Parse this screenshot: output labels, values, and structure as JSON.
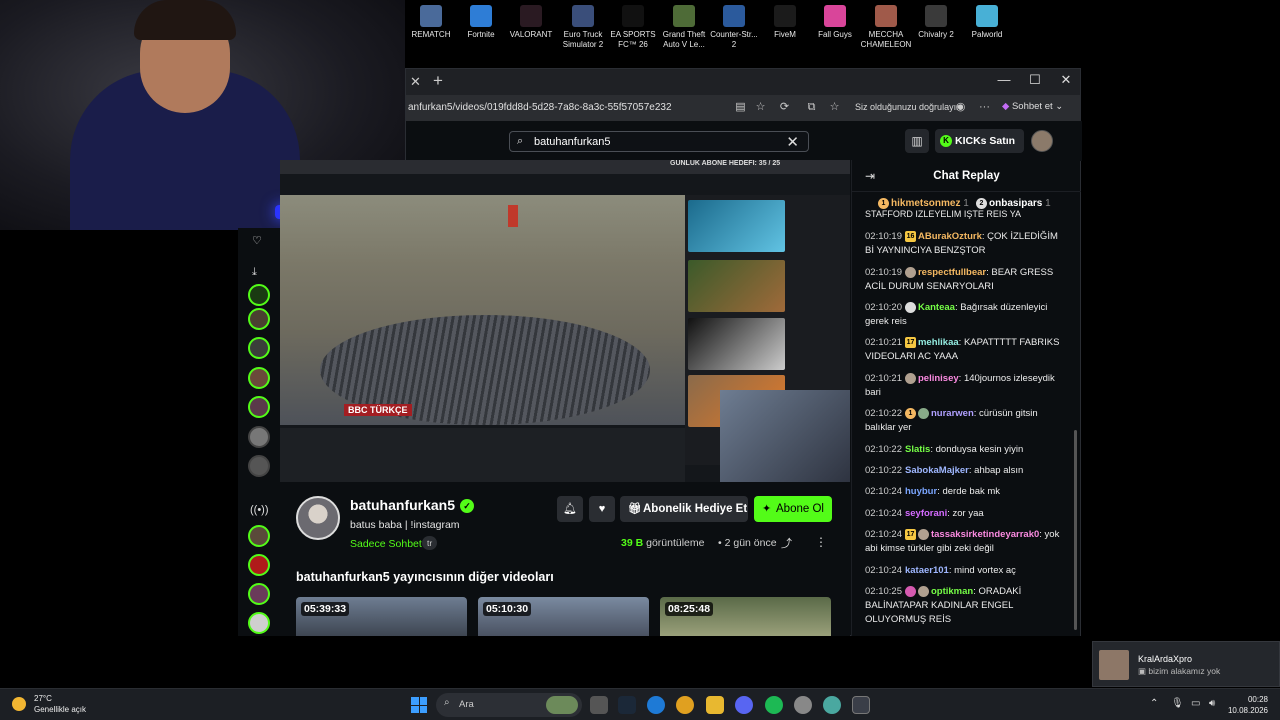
{
  "desktop": {
    "icons": [
      {
        "label1": "REMATCH",
        "label2": "",
        "color": "#4a6a9a"
      },
      {
        "label1": "Fortnite",
        "label2": "",
        "color": "#2e7dd6"
      },
      {
        "label1": "VALORANT",
        "label2": "",
        "color": "#ff4655"
      },
      {
        "label1": "Euro Truck",
        "label2": "Simulator 2",
        "color": "#3a4e7a"
      },
      {
        "label1": "EA SPORTS",
        "label2": "FC™ 26",
        "color": "#111111"
      },
      {
        "label1": "Grand Theft",
        "label2": "Auto V Le...",
        "color": "#4e6b37"
      },
      {
        "label1": "Counter-Str...",
        "label2": "2",
        "color": "#2b5a9c"
      },
      {
        "label1": "FiveM",
        "label2": "",
        "color": "#1f8a3e"
      },
      {
        "label1": "Fall Guys",
        "label2": "",
        "color": "#d9459a"
      },
      {
        "label1": "MECCHA",
        "label2": "CHAMELEON",
        "color": "#a05a4a"
      },
      {
        "label1": "Chivalry 2",
        "label2": "",
        "color": "#c9a54a"
      },
      {
        "label1": "Palworld",
        "label2": "",
        "color": "#48b0d6"
      }
    ]
  },
  "browser": {
    "url": "anfurkan5/videos/019fdd8d-5d28-7a8c-8a3c-55f57057e232",
    "verify_text": "Siz olduğunuzu doğrulayın",
    "chat_btn": "Sohbet et"
  },
  "kick": {
    "search_value": "batuhanfurkan5",
    "kicks_btn": "KICKs Satın Al",
    "video_goal": "GÜNLÜK ABONE HEDEFİ: 35 / 25",
    "bbc_label": "BBC TÜRKÇE",
    "channel": {
      "name": "batuhanfurkan5",
      "bio": "batus baba | !instagram",
      "chat_mode": "Sadece Sohbet",
      "lang": "tr",
      "gift_btn": "Abonelik Hediye Et",
      "sub_btn": "Abone Ol",
      "views_count": "39 B",
      "views_label": "görüntüleme",
      "ago": "2 gün önce"
    },
    "other_videos_title": "batuhanfurkan5 yayıncısının diğer videoları",
    "video_cards": [
      {
        "duration": "05:39:33"
      },
      {
        "duration": "05:10:30"
      },
      {
        "duration": "08:25:48"
      }
    ]
  },
  "chat": {
    "title": "Chat Replay",
    "pinned": [
      {
        "user": "hikmetsonmez",
        "count": "1"
      },
      {
        "user": "onbasipars",
        "count": "1"
      }
    ],
    "cut_top": "STAFFORD İZLEYELİM İŞTE REİS YA",
    "messages": [
      {
        "time": "02:10:19",
        "badge": "16",
        "user": "ABurakOzturk",
        "color": "#f4b862",
        "text": "ÇOK İZLEDİĞİM Bİ YAYNINCIYA BENZŞTOR"
      },
      {
        "time": "02:10:19",
        "badge": "",
        "user": "respectfullbear",
        "color": "#f4b862",
        "text": "BEAR GRESS ACİL DURUM SENARYOLARI"
      },
      {
        "time": "02:10:20",
        "badge": "",
        "user": "Kanteaa",
        "color": "#75fd46",
        "text": "Bağırsak düzenleyici gerek reis"
      },
      {
        "time": "02:10:21",
        "badge": "17",
        "user": "mehlikaa",
        "color": "#93ebe0",
        "text": "KAPATTTTT FABRIKS VIDEOLARI AC YAAA"
      },
      {
        "time": "02:10:21",
        "badge": "",
        "user": "pelinisey",
        "color": "#fa8ae0",
        "text": "140journos izleseydik bari"
      },
      {
        "time": "02:10:22",
        "badge": "1",
        "user": "nurarwen",
        "color": "#b0a0ff",
        "text": "cürüsün gitsin balıklar yer"
      },
      {
        "time": "02:10:22",
        "badge": "",
        "user": "Slatis",
        "color": "#75fd46",
        "text": "donduysa kesin yiyin"
      },
      {
        "time": "02:10:22",
        "badge": "",
        "user": "SabokaMajker",
        "color": "#9fb7ff",
        "text": "ahbap alsın"
      },
      {
        "time": "02:10:24",
        "badge": "",
        "user": "huybur",
        "color": "#7ba6ff",
        "text": "derde bak mk"
      },
      {
        "time": "02:10:24",
        "badge": "",
        "user": "seyforani",
        "color": "#d46bff",
        "text": "zor yaa"
      },
      {
        "time": "02:10:24",
        "badge": "17",
        "user": "tassaksirketindeyarrak0",
        "color": "#fa8ae0",
        "text": "yok abi kimse türkler gibi zeki değil"
      },
      {
        "time": "02:10:24",
        "badge": "",
        "user": "kataer101",
        "color": "#9fb7ff",
        "text": "mind vortex aç"
      },
      {
        "time": "02:10:25",
        "badge": "",
        "user": "optikman",
        "color": "#75fd46",
        "text": "ORADAKİ BALİNATAPAR KADINLAR ENGEL OLUYORMUŞ REİS"
      }
    ]
  },
  "taskbar": {
    "temp": "27°C",
    "weather": "Genellikle açık",
    "search": "Ara",
    "time": "00:28",
    "date": "10.08.2026"
  },
  "notification": {
    "user": "KralArdaXpro",
    "text": "bizim alakamız yok"
  }
}
